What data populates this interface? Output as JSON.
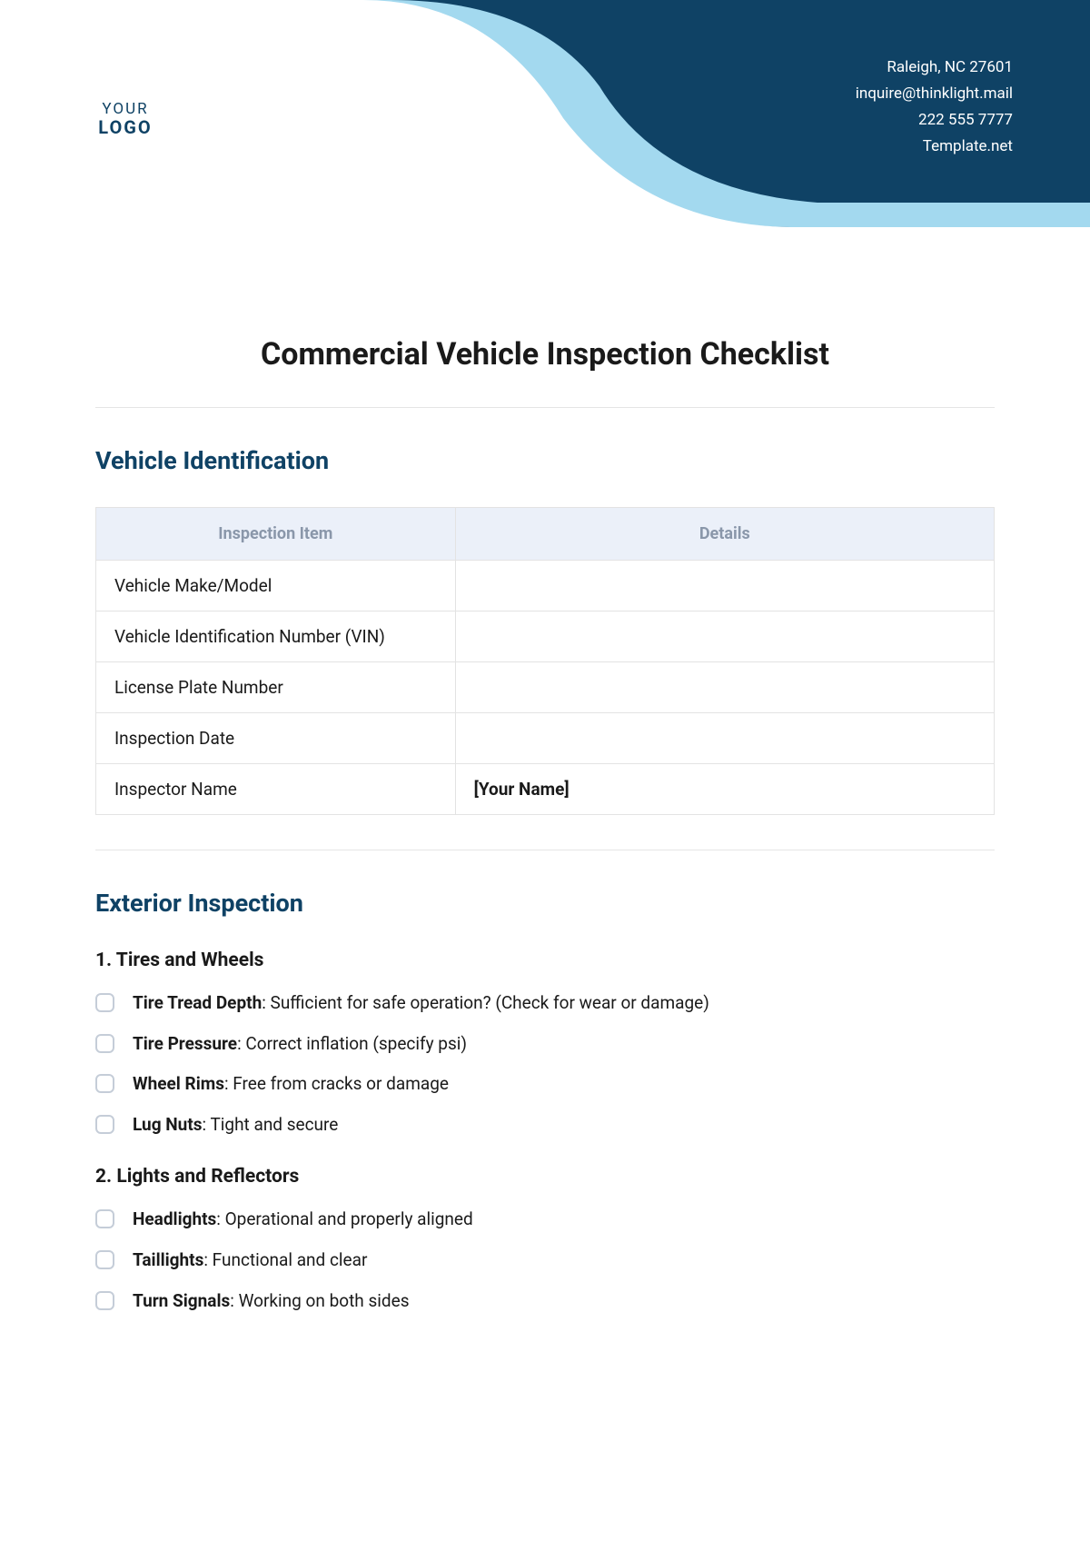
{
  "logo": {
    "top": "YOUR",
    "bottom": "LOGO"
  },
  "header_contact": {
    "location": "Raleigh, NC 27601",
    "email": "inquire@thinklight.mail",
    "phone": "222 555 7777",
    "site": "Template.net"
  },
  "page_title": "Commercial Vehicle Inspection Checklist",
  "section1": {
    "title": "Vehicle Identification",
    "headers": {
      "col1": "Inspection Item",
      "col2": "Details"
    },
    "rows": [
      {
        "item": "Vehicle Make/Model",
        "details": ""
      },
      {
        "item": "Vehicle Identification Number (VIN)",
        "details": ""
      },
      {
        "item": "License Plate Number",
        "details": ""
      },
      {
        "item": "Inspection Date",
        "details": ""
      },
      {
        "item": "Inspector Name",
        "details": "[Your Name]"
      }
    ]
  },
  "section2": {
    "title": "Exterior Inspection",
    "sub1": {
      "title": "1. Tires and Wheels",
      "items": [
        {
          "label": "Tire Tread Depth",
          "desc": ": Sufficient for safe operation? (Check for wear or damage)"
        },
        {
          "label": "Tire Pressure",
          "desc": ": Correct inflation (specify psi)"
        },
        {
          "label": "Wheel Rims",
          "desc": ": Free from cracks or damage"
        },
        {
          "label": "Lug Nuts",
          "desc": ": Tight and secure"
        }
      ]
    },
    "sub2": {
      "title": "2. Lights and Reflectors",
      "items": [
        {
          "label": "Headlights",
          "desc": ": Operational and properly aligned"
        },
        {
          "label": "Taillights",
          "desc": ": Functional and clear"
        },
        {
          "label": "Turn Signals",
          "desc": ": Working on both sides"
        }
      ]
    }
  }
}
